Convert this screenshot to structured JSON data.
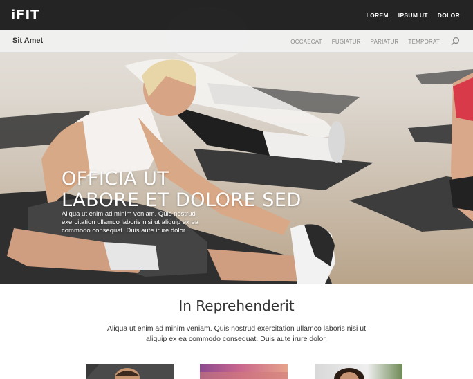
{
  "header": {
    "logo_text": "iFIT",
    "nav": [
      "LOREM",
      "IPSUM UT",
      "DOLOR"
    ]
  },
  "subheader": {
    "brand": "Sit Amet",
    "nav": [
      "OCCAECAT",
      "FUGIATUR",
      "PARIATUR",
      "TEMPORAT"
    ],
    "search_icon": "search-icon"
  },
  "hero": {
    "title_line1": "OFFICIA UT",
    "title_line2": "LABORE ET DOLORE SED",
    "text": "Aliqua ut enim ad minim veniam. Quis nostrud exercitation ullamco laboris nisi ut aliquip ex ea commodo consequat. Duis aute irure dolor."
  },
  "section": {
    "title": "In Reprehenderit",
    "text": "Aliqua ut enim ad minim veniam. Quis nostrud exercitation ullamco laboris nisi ut aliquip ex ea commodo consequat. Duis aute irure dolor."
  },
  "colors": {
    "topbar": "#161616",
    "subbar": "#f0f0f0",
    "text_dark": "#333333"
  }
}
